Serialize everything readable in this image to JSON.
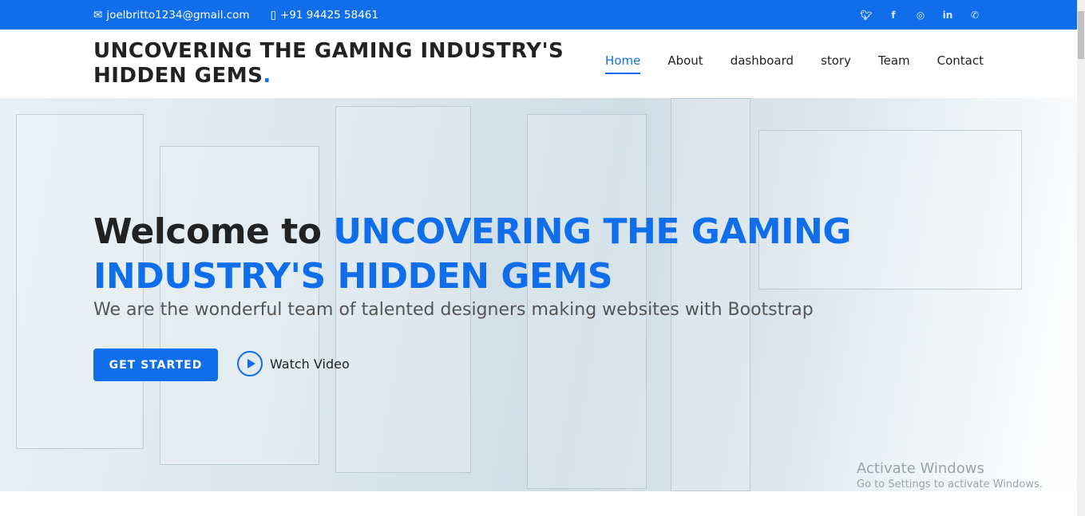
{
  "topbar": {
    "email": "joelbritto1234@gmail.com",
    "phone": "+91 94425 58461",
    "socials": [
      "twitter-icon",
      "facebook-icon",
      "instagram-icon",
      "linkedin-icon",
      "whatsapp-icon"
    ]
  },
  "header": {
    "logo": "UNCOVERING THE GAMING INDUSTRY'S HIDDEN GEMS",
    "logo_dot": ".",
    "nav": [
      "Home",
      "About",
      "dashboard",
      "story",
      "Team",
      "Contact"
    ]
  },
  "hero": {
    "title_prefix": "Welcome to ",
    "title_highlight": "UNCOVERING THE GAMING INDUSTRY'S HIDDEN GEMS",
    "subtitle": "We are the wonderful team of talented designers making websites with Bootstrap",
    "cta": "GET STARTED",
    "watch": "Watch Video"
  },
  "watermark": {
    "line1": "Activate Windows",
    "line2": "Go to Settings to activate Windows."
  },
  "colors": {
    "accent": "#106eea"
  }
}
